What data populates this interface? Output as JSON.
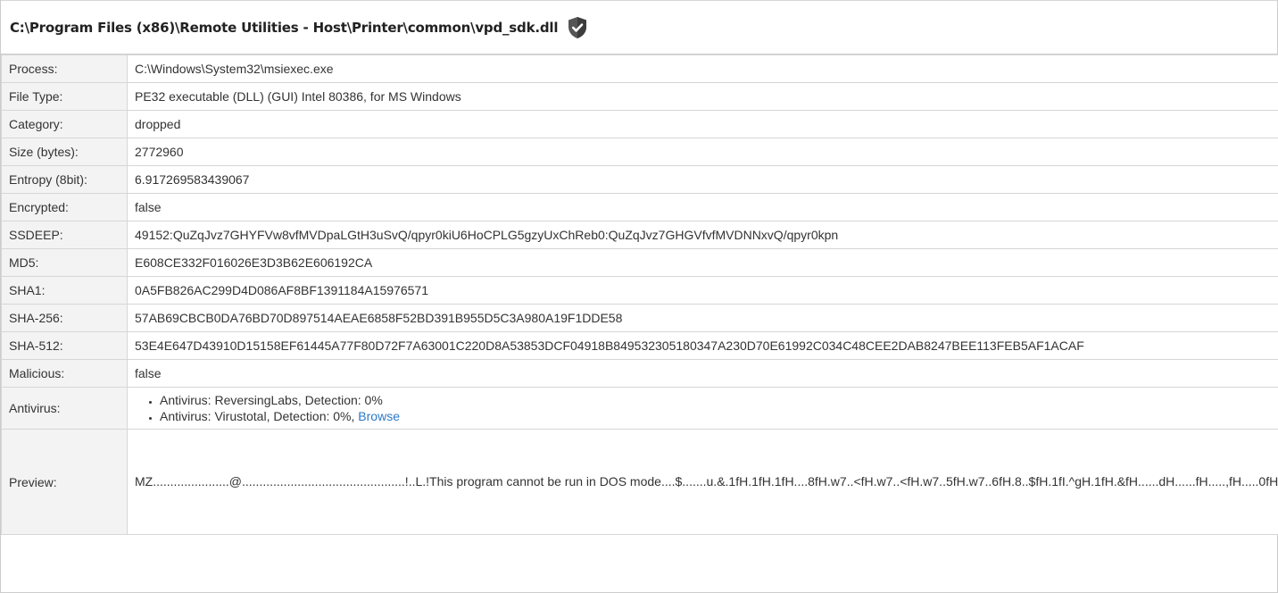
{
  "header": {
    "path": "C:\\Program Files (x86)\\Remote Utilities - Host\\Printer\\common\\vpd_sdk.dll",
    "shield_icon": "shield-check-icon"
  },
  "rows": [
    {
      "label": "Process:",
      "value": "C:\\Windows\\System32\\msiexec.exe"
    },
    {
      "label": "File Type:",
      "value": "PE32 executable (DLL) (GUI) Intel 80386, for MS Windows"
    },
    {
      "label": "Category:",
      "value": "dropped"
    },
    {
      "label": "Size (bytes):",
      "value": "2772960"
    },
    {
      "label": "Entropy (8bit):",
      "value": "6.917269583439067"
    },
    {
      "label": "Encrypted:",
      "value": "false"
    },
    {
      "label": "SSDEEP:",
      "value": "49152:QuZqJvz7GHYFVw8vfMVDpaLGtH3uSvQ/qpyr0kiU6HoCPLG5gzyUxChReb0:QuZqJvz7GHGVfvfMVDNNxvQ/qpyr0kpn"
    },
    {
      "label": "MD5:",
      "value": "E608CE332F016026E3D3B62E606192CA"
    },
    {
      "label": "SHA1:",
      "value": "0A5FB826AC299D4D086AF8BF1391184A15976571"
    },
    {
      "label": "SHA-256:",
      "value": "57AB69CBCB0DA76BD70D897514AEAE6858F52BD391B955D5C3A980A19F1DDE58"
    },
    {
      "label": "SHA-512:",
      "value": "53E4E647D43910D15158EF61445A77F80D72F7A63001C220D8A53853DCF04918B849532305180347A230D70E61992C034C48CEE2DAB8247BEE113FEB5AF1ACAF"
    },
    {
      "label": "Malicious:",
      "value": "false"
    }
  ],
  "antivirus": {
    "label": "Antivirus:",
    "items": [
      "Antivirus: ReversingLabs, Detection: 0%",
      "Antivirus: Virustotal, Detection: 0%, "
    ],
    "browse_label": "Browse"
  },
  "preview": {
    "label": "Preview:",
    "text": "MZ......................@...............................................!..L.!This program cannot be run in DOS mode....$.......u.&.1fH.1fH.1fH....8fH.w7..<fH.w7..<fH.w7..5fH.w7..6fH.8..$fH.1fI.^gH.1fH.&fH......dH......fH.....,fH.....0fH.<4..0fH.....0fH.Rich1fH.................PE..L...,..[...........!.........j......#......... ...............................*.......*...@..........................p.'..:..T.(.......)...............*..!....).8|..0. .8............................8'.@............ .h............................text............................... ..`.rdata...-.... ....... .............@..@.data........@(..~...0(.............@....rsrc.........)........(.............@..@.reloc..8|....)..~....(.............@..B..................................................................................................................................................................................................................................................................."
  }
}
